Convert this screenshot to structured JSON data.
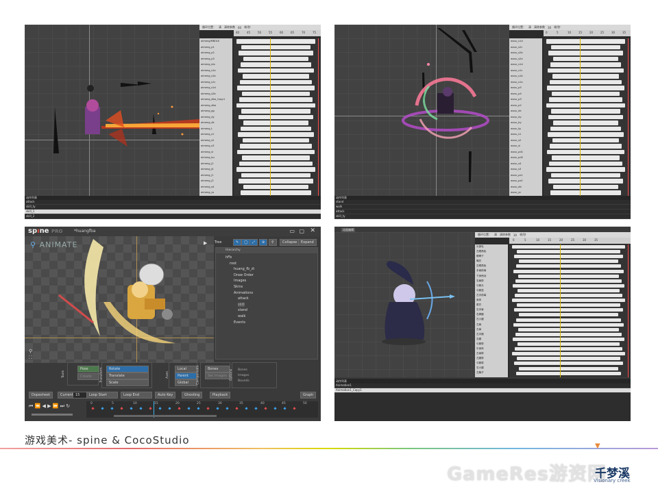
{
  "panel_tl": {
    "tracks": [
      "aimeng/MBOLE",
      "aimeng_p1",
      "aimeng_p2",
      "aimeng_p3",
      "aimeng_elo",
      "aimeng_s1a",
      "aimeng_s1b",
      "aimeng_s1c",
      "aimeng_s1d",
      "aimeng_s2b",
      "aimeng_dba_Copy1",
      "aimeng_dba",
      "aimeng_gg",
      "aimeng_dy",
      "aimeng_dk",
      "aimeng_t",
      "aimeng_s1",
      "aimeng_s2",
      "aimeng_s3",
      "aimeng_sl",
      "aimeng_bu",
      "aimeng_j2",
      "aimeng_j4",
      "aimeng_j1",
      "aimeng_j3",
      "aimeng_s4",
      "aimeng_ys"
    ],
    "ruler": [
      "40",
      "45",
      "50",
      "55",
      "60",
      "65",
      "70",
      "75"
    ],
    "toolbar": [
      "循环位置：",
      "清",
      "清除参数",
      "60",
      "帧/秒"
    ],
    "list_title": "动作列表",
    "animations": [
      "attack",
      "skill_ty",
      "skill_1",
      "skill_2"
    ],
    "selected": 2
  },
  "panel_tr": {
    "tracks": [
      "wusu_s1d",
      "wusu_s2c",
      "wusu_s2b",
      "wusu_s2a",
      "wusu_s1d",
      "wusu_s1c",
      "wusu_s1b",
      "wusu_s1a",
      "wusu_p5",
      "wusu_p4",
      "wusu_p3",
      "wusu_p2",
      "wusu_dk",
      "wusu_dy",
      "wusu_by",
      "wusu_fg",
      "wusu_s1",
      "wusu_s2",
      "wusu_sl",
      "wusu_pd1",
      "wusu_pd2",
      "wusu_s4",
      "wusu_s3",
      "wusu_pz1",
      "wusu_pz2",
      "wusu_db",
      "wusu_yc"
    ],
    "ruler": [
      "0",
      "5",
      "10",
      "15",
      "20",
      "25",
      "30",
      "35"
    ],
    "toolbar": [
      "循环位置：",
      "清",
      "清除参数",
      "30",
      "帧/秒"
    ],
    "list_title": "动作列表",
    "animations": [
      "stand",
      "walk",
      "attack",
      "skill_ty"
    ],
    "selected": -1
  },
  "panel_bl": {
    "logo_prefix": "sp",
    "logo_mid": "ı",
    "logo_suffix": "ne",
    "edition": "PRO",
    "filename": "*huangfba",
    "mode_label": "ANIMATE",
    "tree_title": "Tree",
    "collapse": "Collapse",
    "expand": "Expand",
    "hierarchy": "Hierarchy",
    "tree": [
      "hFb",
      "root",
      "huang_fb_zt",
      "Draw Order",
      "Images",
      "Skins",
      "Animations",
      "attack",
      "skill",
      "stand",
      "walk",
      "Events"
    ],
    "tools_title": "Tools",
    "pose": "Pose",
    "create": "Create",
    "transform_title": "Transform",
    "rotate": "Rotate",
    "translate": "Translate",
    "scale": "Scale",
    "axes_title": "Axes",
    "local": "Local",
    "parent": "Parent",
    "global": "Global",
    "compensate_title": "Compensate",
    "bones": "Bones",
    "set_images": "Set Images",
    "options_title": "Options",
    "opt_bones": "Bones",
    "opt_images": "Images",
    "opt_bounds": "Bounds",
    "dopesheet": "Dopesheet",
    "current": "Current",
    "current_val": "15",
    "loop_start": "Loop Start",
    "loop_end": "Loop End",
    "autokey": "Auto Key",
    "ghosting": "Ghosting",
    "playback": "Playback",
    "graph": "Graph",
    "timeline_ticks": [
      "0",
      "5",
      "10",
      "15",
      "20",
      "25",
      "30",
      "35",
      "40",
      "45",
      "50"
    ]
  },
  "panel_br": {
    "title": "动画编辑",
    "tracks": [
      "头部毛",
      "左眼角色",
      "眼睛下",
      "嘴巴",
      "右眼角色",
      "手臂前臂",
      "下身甩动",
      "右肩带",
      "弓箭头",
      "弓箭弦",
      "左手前臂",
      "身体",
      "尾巴",
      "右手臂",
      "右脚腿",
      "左小腿",
      "左肩",
      "左臂",
      "左手腕",
      "右腿",
      "弓箭带",
      "中身体",
      "左臂带",
      "左腿带",
      "弓箭带",
      "右小腿",
      "左胸子"
    ],
    "ruler": [
      "0",
      "5",
      "10",
      "15",
      "20",
      "25",
      "30",
      "35"
    ],
    "toolbar": [
      "循环位置：",
      "清",
      "清除参数",
      "30",
      "帧/秒"
    ],
    "list_title": "动作列表",
    "animations": [
      "Animation1",
      "Animation1_Copy1"
    ],
    "selected": 1
  },
  "caption": "游戏美术- spine & CocoStudio",
  "watermark": "GameRes游资网",
  "logo_cn": "千梦溪",
  "logo_en": "Visionary creek"
}
